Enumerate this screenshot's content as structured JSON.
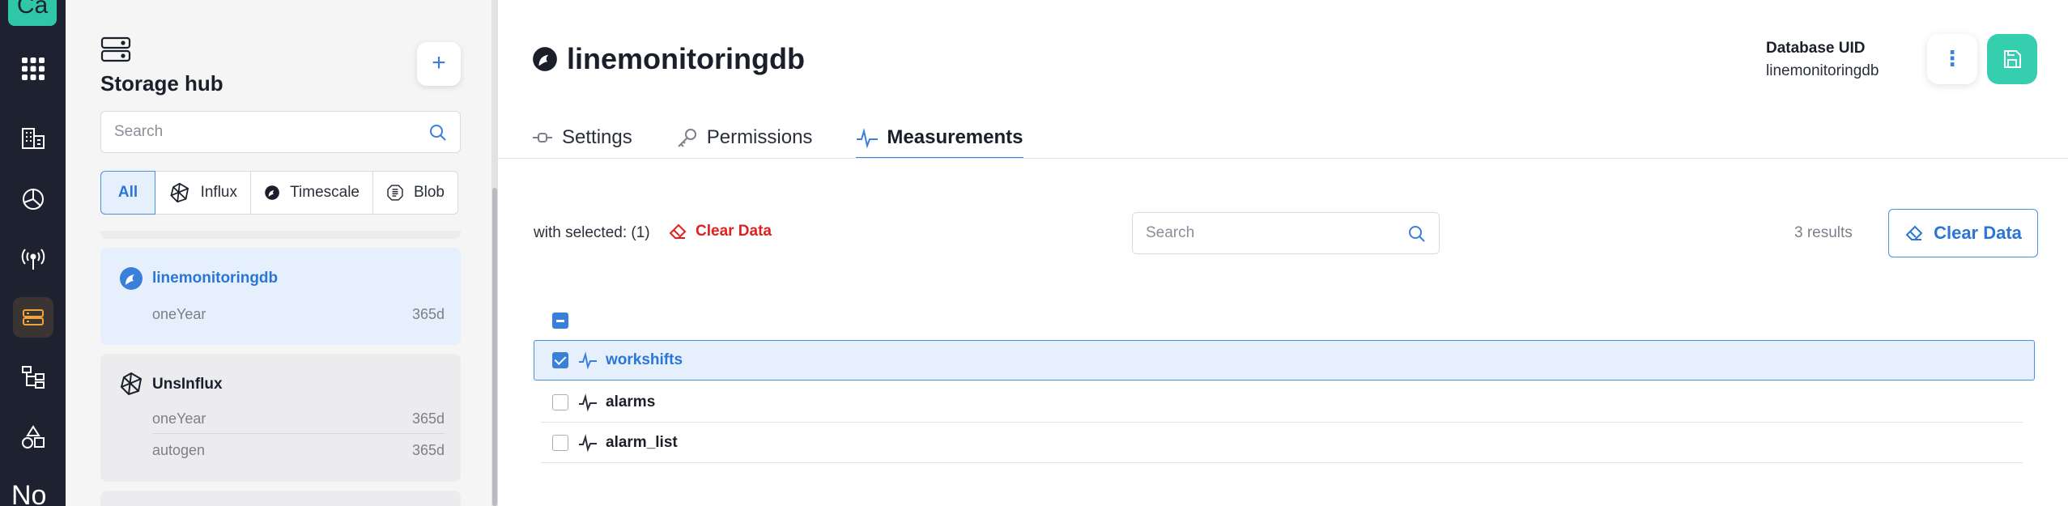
{
  "rail": {
    "top_logo": "Ca",
    "bottom_logo": "No",
    "items": [
      {
        "icon": "apps-grid-icon"
      },
      {
        "icon": "buildings-icon"
      },
      {
        "icon": "pie-chart-icon"
      },
      {
        "icon": "antenna-icon"
      },
      {
        "icon": "storage-icon",
        "active": true
      },
      {
        "icon": "tree-structure-icon"
      },
      {
        "icon": "shapes-icon"
      }
    ]
  },
  "storage_hub": {
    "title": "Storage hub",
    "search_placeholder": "Search",
    "filters": [
      {
        "label": "All",
        "active": true
      },
      {
        "label": "Influx",
        "icon": "influx-icon"
      },
      {
        "label": "Timescale",
        "icon": "timescale-icon"
      },
      {
        "label": "Blob",
        "icon": "blob-icon"
      }
    ],
    "databases": [
      {
        "name": "linemonitoringdb",
        "type": "timescale",
        "selected": true,
        "policies": [
          {
            "name": "oneYear",
            "duration": "365d"
          }
        ]
      },
      {
        "name": "UnsInflux",
        "type": "influx",
        "selected": false,
        "policies": [
          {
            "name": "oneYear",
            "duration": "365d"
          },
          {
            "name": "autogen",
            "duration": "365d"
          }
        ]
      }
    ]
  },
  "main": {
    "title": "linemonitoringdb",
    "uid_label": "Database UID",
    "uid_value": "linemonitoringdb",
    "tabs": [
      {
        "label": "Settings",
        "icon": "settings-slider-icon"
      },
      {
        "label": "Permissions",
        "icon": "key-icon"
      },
      {
        "label": "Measurements",
        "icon": "measurement-wave-icon",
        "active": true
      }
    ],
    "toolbar": {
      "with_selected": "with selected: (1)",
      "clear_data_link": "Clear Data",
      "search_placeholder": "Search",
      "results": "3 results",
      "clear_data_button": "Clear Data"
    },
    "measurements": [
      {
        "name": "workshifts",
        "checked": true
      },
      {
        "name": "alarms",
        "checked": false
      },
      {
        "name": "alarm_list",
        "checked": false
      }
    ]
  },
  "colors": {
    "accent": "#3a7fd8",
    "save": "#35cfb0",
    "danger": "#e02020",
    "rail_bg": "#1e2230"
  }
}
